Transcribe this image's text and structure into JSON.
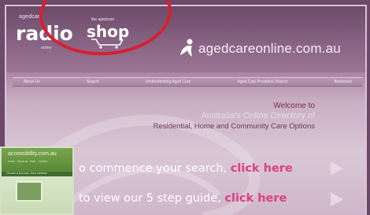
{
  "header": {
    "radio_logo": {
      "small_text": "agedcare",
      "main_text": "radio",
      "sub_text": "online"
    },
    "shop_logo": {
      "small_text": "the agedcare",
      "main_text": "shop"
    },
    "site_logo": {
      "text": "agedcareonline.com.au"
    }
  },
  "nav": {
    "items": [
      "About Us",
      "Search",
      "Understanding Aged Care",
      "Aged Care Providers Search",
      "Bookmark"
    ]
  },
  "welcome": {
    "line1": "Welcome to",
    "line2": "Australia's Online Directory of",
    "line3": "Residential, Home and Community Care Options"
  },
  "cta": [
    {
      "lead": "o commence your search,",
      "link": "click here"
    },
    {
      "lead": "to view our 5 step guide,",
      "link": "click here"
    }
  ],
  "thumbnail": {
    "title": "accessibility.com.au",
    "subtitle": "home · about us · links · contact",
    "bar_text": "Choose a font size, then continue"
  },
  "colors": {
    "accent": "#e23d82",
    "annotation_ring": "#d72030"
  }
}
